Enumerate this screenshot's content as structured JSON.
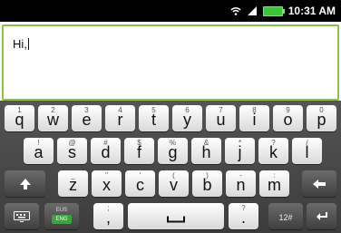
{
  "status": {
    "time": "10:31 AM"
  },
  "textbox": {
    "value": "Hi,"
  },
  "keyboard": {
    "row1": [
      {
        "sec": "1",
        "pri": "q"
      },
      {
        "sec": "2",
        "pri": "w"
      },
      {
        "sec": "3",
        "pri": "e"
      },
      {
        "sec": "4",
        "pri": "r"
      },
      {
        "sec": "5",
        "pri": "t"
      },
      {
        "sec": "6",
        "pri": "y"
      },
      {
        "sec": "7",
        "pri": "u"
      },
      {
        "sec": "8",
        "pri": "i"
      },
      {
        "sec": "9",
        "pri": "o"
      },
      {
        "sec": "0",
        "pri": "p"
      }
    ],
    "row2": [
      {
        "sec": "!",
        "pri": "a"
      },
      {
        "sec": "@",
        "pri": "s"
      },
      {
        "sec": "#",
        "pri": "d"
      },
      {
        "sec": "$",
        "pri": "f"
      },
      {
        "sec": "%",
        "pri": "g"
      },
      {
        "sec": "&",
        "pri": "h"
      },
      {
        "sec": "*",
        "pri": "j"
      },
      {
        "sec": "?",
        "pri": "k"
      },
      {
        "sec": "/",
        "pri": "l"
      }
    ],
    "row3": [
      {
        "sec": "_",
        "pri": "z"
      },
      {
        "sec": "\"",
        "pri": "x"
      },
      {
        "sec": "'",
        "pri": "c"
      },
      {
        "sec": "(",
        "pri": "v"
      },
      {
        "sec": ")",
        "pri": "b"
      },
      {
        "sec": "-",
        "pri": "n"
      },
      {
        "sec": ":",
        "pri": "m"
      }
    ],
    "lang_top": "EUS",
    "lang_bottom": "ENG",
    "comma_key": ",",
    "comma_sec": ";",
    "period_key": ".",
    "period_sec": "?",
    "symbols_label": "12#"
  }
}
